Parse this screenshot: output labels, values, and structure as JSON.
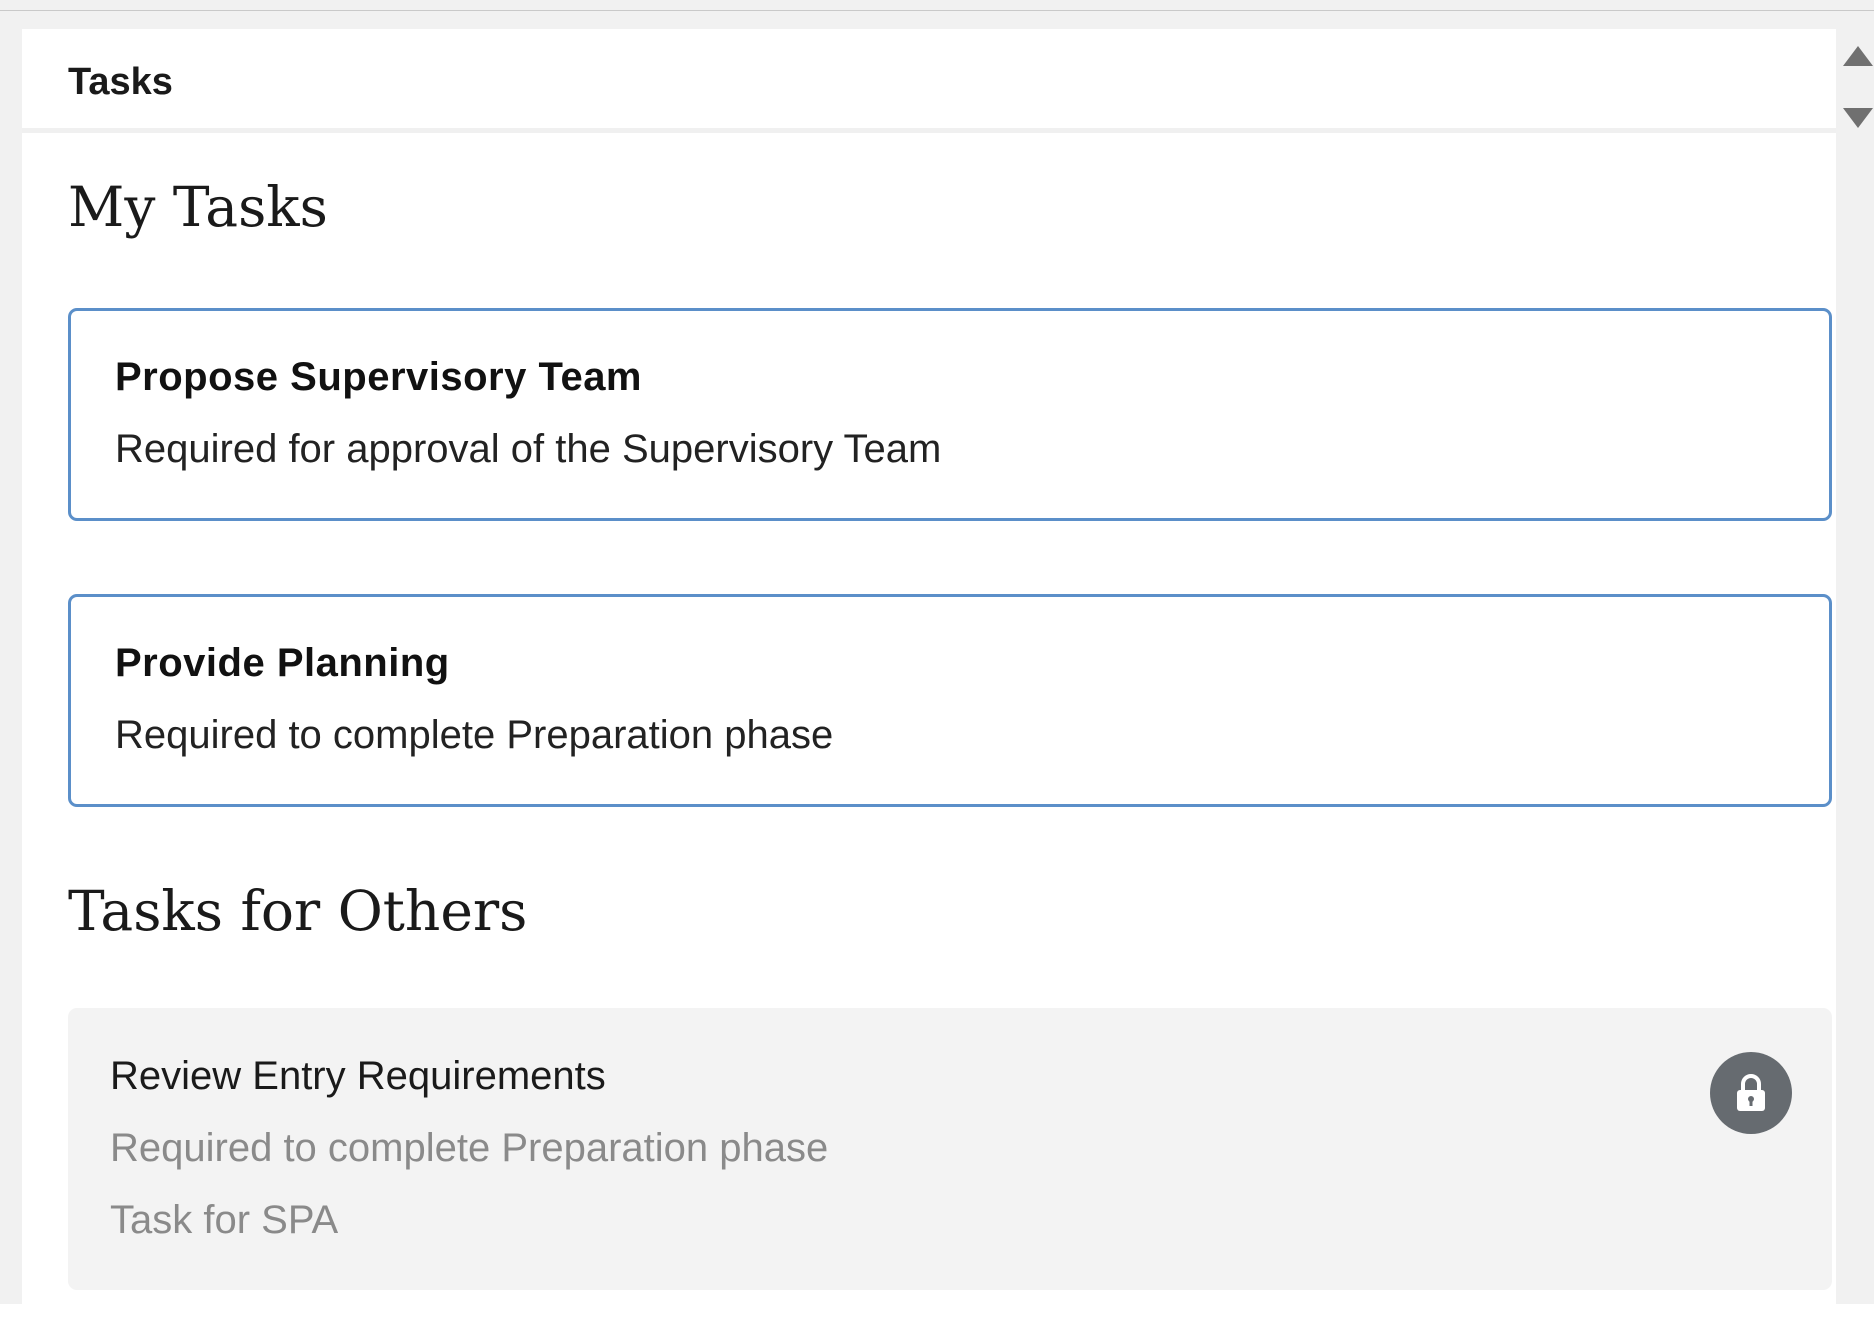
{
  "panel": {
    "header_title": "Tasks"
  },
  "my_tasks": {
    "title": "My Tasks",
    "items": [
      {
        "title": "Propose Supervisory Team",
        "description": "Required for approval of the Supervisory Team"
      },
      {
        "title": "Provide Planning",
        "description": "Required to complete Preparation phase"
      }
    ]
  },
  "tasks_for_others": {
    "title": "Tasks for Others",
    "items": [
      {
        "title": "Review Entry Requirements",
        "description": "Required to complete Preparation phase",
        "owner": "Task for SPA",
        "status_icon": "lock-icon"
      }
    ]
  },
  "colors": {
    "card_border": "#5b8fc9",
    "locked_card_bg": "#f3f3f3",
    "lock_badge_bg": "#666b70",
    "muted_text": "#8a8a8a"
  }
}
